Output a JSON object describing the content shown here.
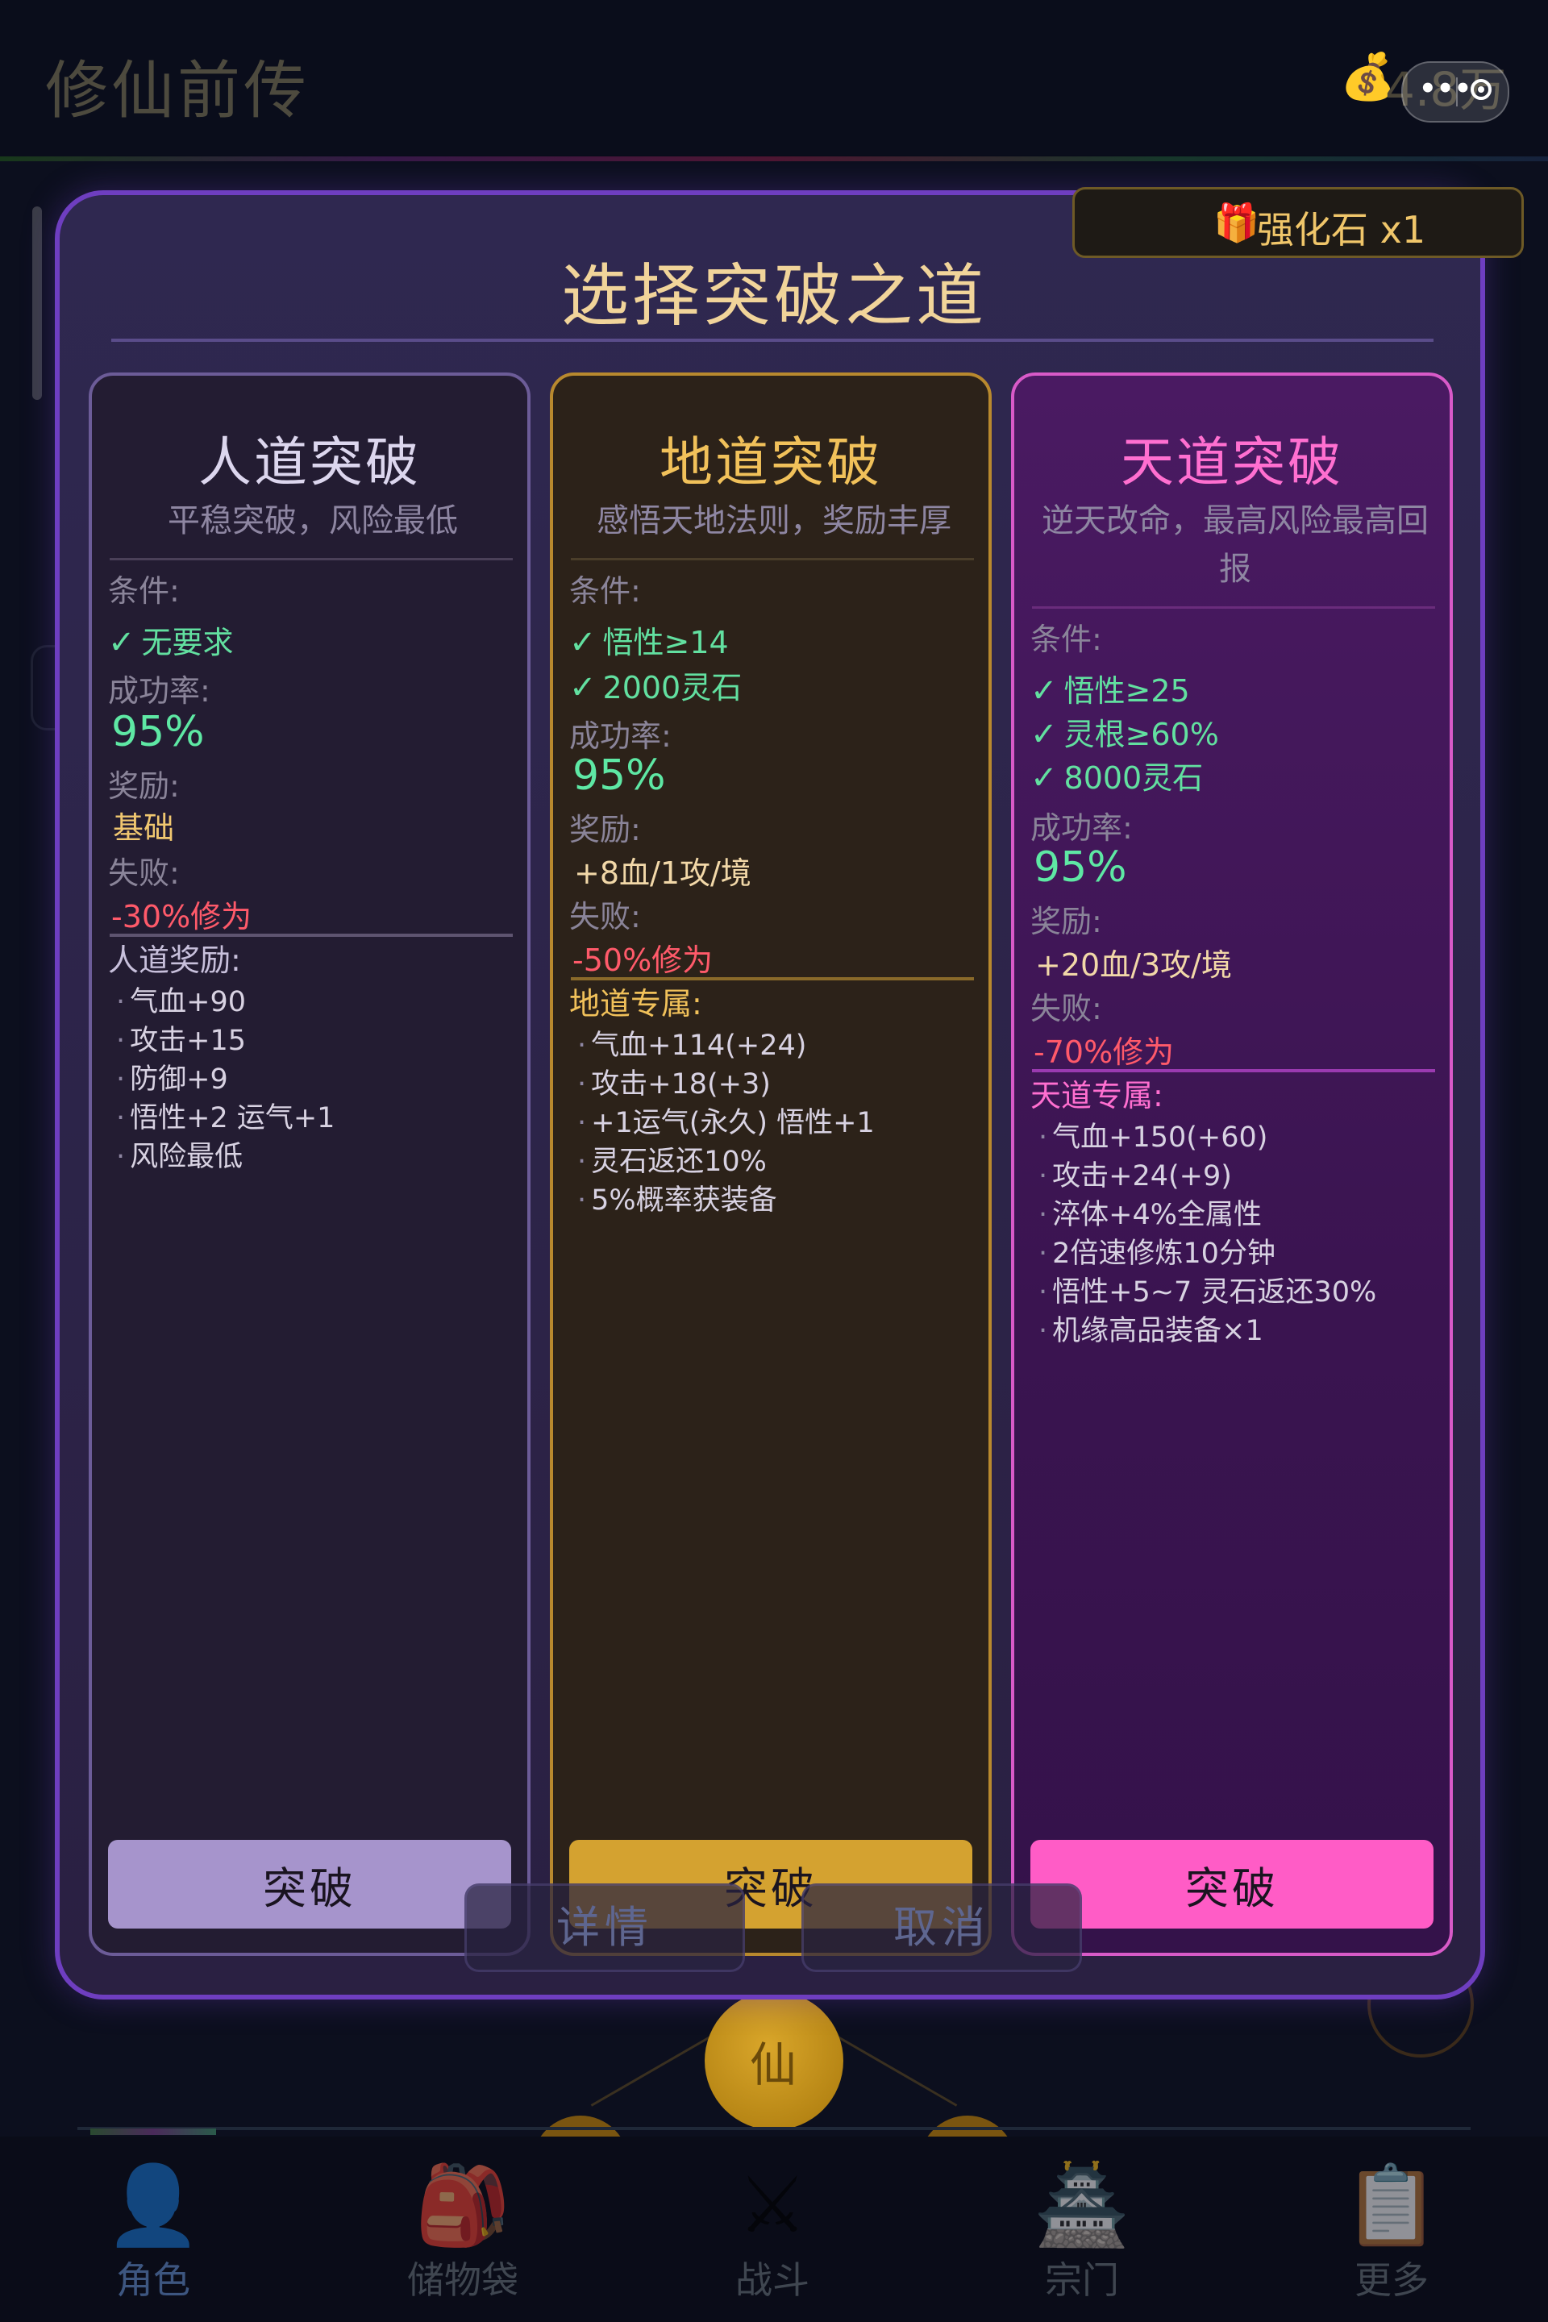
{
  "app": {
    "title": "修仙前传",
    "coin_icon": "money-bag-icon",
    "coin_value": "4.8万"
  },
  "badge": {
    "icon": "gift-icon",
    "label": "强化石 x1"
  },
  "modal": {
    "title": "选择突破之道"
  },
  "labels": {
    "condition": "条件:",
    "rate": "成功率:",
    "reward": "奖励:",
    "fail": "失败:"
  },
  "paths": [
    {
      "title": "人道突破",
      "subtitle": "平稳突破，风险最低",
      "conditions": [
        "无要求"
      ],
      "rate": "95%",
      "reward": "基础",
      "fail": "-30%修为",
      "bonus_title": "人道奖励:",
      "bonus": [
        "气血+90",
        "攻击+15",
        "防御+9",
        "悟性+2 运气+1",
        "风险最低"
      ],
      "button": "突破",
      "accent": "#a694cc"
    },
    {
      "title": "地道突破",
      "subtitle": "感悟天地法则，奖励丰厚",
      "conditions": [
        "悟性≥14",
        "2000灵石"
      ],
      "rate": "95%",
      "reward": "+8血/1攻/境",
      "fail": "-50%修为",
      "bonus_title": "地道专属:",
      "bonus": [
        "气血+114(+24)",
        "攻击+18(+3)",
        "+1运气(永久) 悟性+1",
        "灵石返还10%",
        "5%概率获装备"
      ],
      "button": "突破",
      "accent": "#d4a230"
    },
    {
      "title": "天道突破",
      "subtitle_line1": "逆天改命，最高风险最高回",
      "subtitle_line2": "报",
      "conditions": [
        "悟性≥25",
        "灵根≥60%",
        "8000灵石"
      ],
      "rate": "95%",
      "reward": "+20血/3攻/境",
      "fail": "-70%修为",
      "bonus_title": "天道专属:",
      "bonus": [
        "气血+150(+60)",
        "攻击+24(+9)",
        "淬体+4%全属性",
        "2倍速修炼10分钟",
        "悟性+5~7 灵石返还30%",
        "机缘高品装备×1"
      ],
      "button": "突破",
      "accent": "#ff5cc6"
    }
  ],
  "overlay": {
    "details": "详情",
    "cancel": "取消"
  },
  "background": {
    "center_glyph": "仙"
  },
  "tabs": [
    {
      "label": "角色",
      "icon": "person-icon"
    },
    {
      "label": "储物袋",
      "icon": "backpack-icon"
    },
    {
      "label": "战斗",
      "icon": "crossed-swords-icon"
    },
    {
      "label": "宗门",
      "icon": "pagoda-icon"
    },
    {
      "label": "更多",
      "icon": "clipboard-icon"
    }
  ]
}
